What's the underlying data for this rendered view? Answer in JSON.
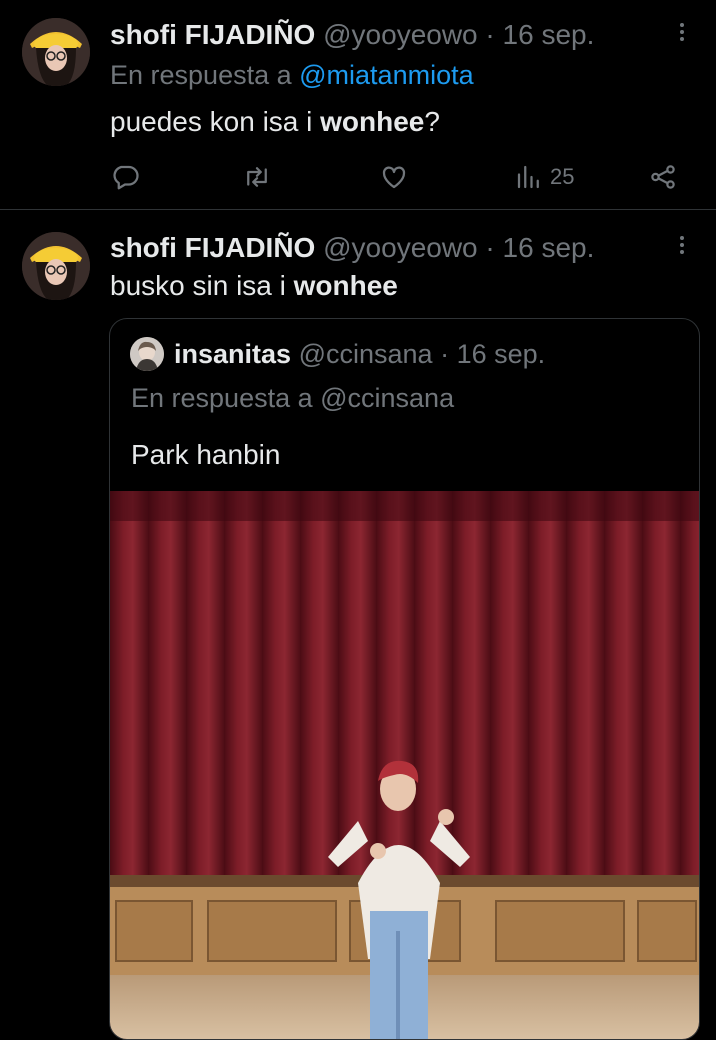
{
  "tweets": [
    {
      "author_name": "shofi FIJADIÑO",
      "handle": "@yooyeowo",
      "separator": "·",
      "date": "16 sep.",
      "reply_prefix": "En respuesta a",
      "reply_to": "@miatanmiota",
      "text_plain": "puedes kon isa i ",
      "text_bold": "wonhee",
      "text_suffix": "?",
      "views": "25",
      "avatar_icon": "avatar-yellow-hat",
      "more_icon": "more-icon"
    },
    {
      "author_name": "shofi FIJADIÑO",
      "handle": "@yooyeowo",
      "separator": "·",
      "date": "16 sep.",
      "text_plain": "busko sin isa i ",
      "text_bold": "wonhee",
      "avatar_icon": "avatar-yellow-hat",
      "more_icon": "more-icon"
    }
  ],
  "quote": {
    "author_name": "insanitas",
    "handle": "@ccinsana",
    "separator": "·",
    "date": "16 sep.",
    "reply_line": "En respuesta a @ccinsana",
    "text": "Park hanbin",
    "image_icon": "photo-stage-curtain"
  },
  "action_icons": [
    "reply-icon",
    "retweet-icon",
    "like-icon",
    "views-icon",
    "share-icon"
  ],
  "colors": {
    "background": "#000000",
    "text": "#e7e9ea",
    "muted": "#71767b",
    "link": "#1d9bf0",
    "border": "#2f3336"
  }
}
